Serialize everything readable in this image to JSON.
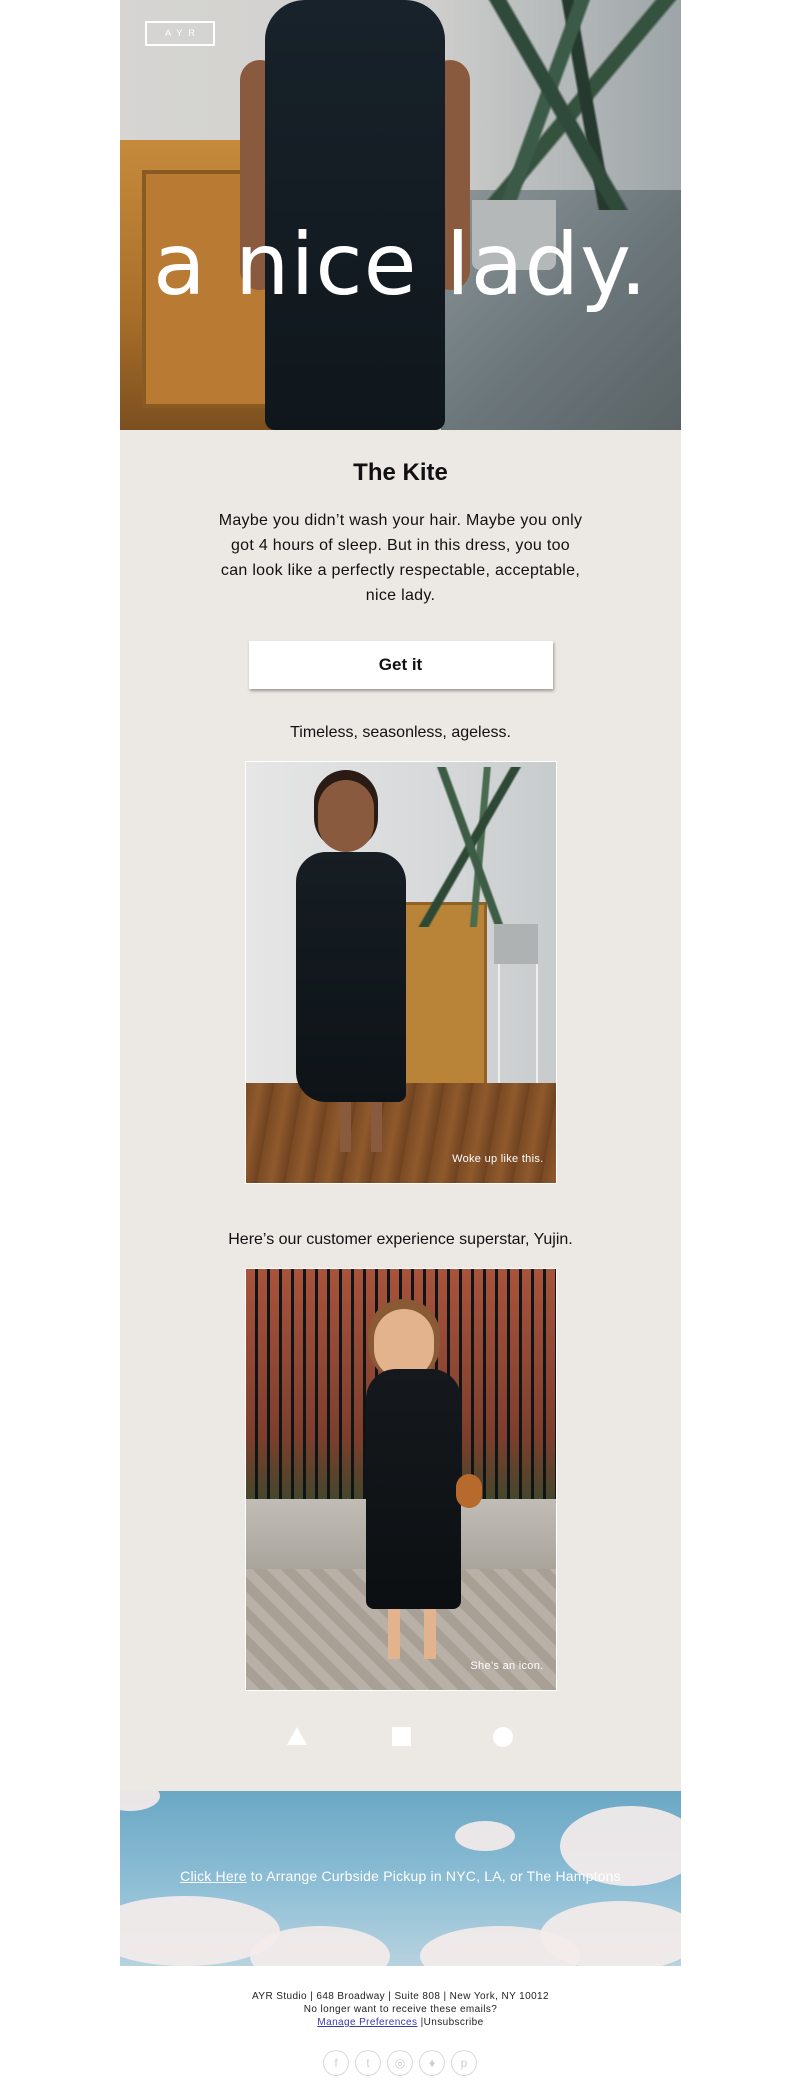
{
  "hero": {
    "logo": "AYR",
    "headline": "a nice lady."
  },
  "product": {
    "title": "The Kite",
    "intro": "Maybe you didn’t wash your hair. Maybe you only got 4 hours of sleep. But in this dress, you too can look like a perfectly respectable, acceptable, nice lady.",
    "cta_label": "Get it",
    "tagline": "Timeless, seasonless, ageless."
  },
  "photos": [
    {
      "caption": "Woke up like this."
    },
    {
      "caption": "She’s an icon."
    }
  ],
  "customer_text": "Here’s our customer experience superstar, Yujin.",
  "shapes": [
    "triangle-icon",
    "square-icon",
    "circle-icon"
  ],
  "pickup_banner": {
    "link_text": "Click Here",
    "text": " to Arrange Curbside Pickup in NYC, LA, or The Hamptons"
  },
  "footer": {
    "address": "AYR Studio | 648 Broadway | Suite 808 | New York, NY 10012",
    "unsubscribe_prompt": "No longer want to receive these emails?",
    "manage_preferences": "Manage Preferences",
    "separator": " |",
    "unsubscribe": "Unsubscribe"
  },
  "social": [
    {
      "icon": "facebook-icon",
      "glyph": "f"
    },
    {
      "icon": "tumblr-icon",
      "glyph": "t"
    },
    {
      "icon": "instagram-icon",
      "glyph": "◎"
    },
    {
      "icon": "twitter-icon",
      "glyph": "♦"
    },
    {
      "icon": "pinterest-icon",
      "glyph": "p"
    }
  ],
  "colors": {
    "panel_bg": "#ece8e4",
    "text": "#111111",
    "link": "#3a3aa8"
  }
}
